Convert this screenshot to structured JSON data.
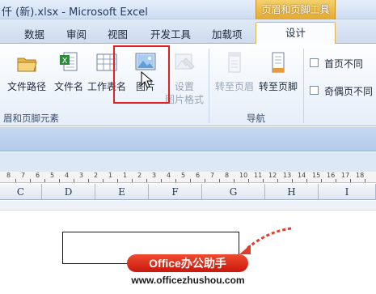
{
  "window": {
    "title": "仟 (新).xlsx - Microsoft Excel",
    "context_tab_title": "页眉和页脚工具"
  },
  "tabs": [
    {
      "label": "数据"
    },
    {
      "label": "审阅"
    },
    {
      "label": "视图"
    },
    {
      "label": "开发工具"
    },
    {
      "label": "加载项"
    }
  ],
  "active_tab": {
    "label": "设计"
  },
  "ribbon": {
    "elements_group": {
      "label": "眉和页脚元素",
      "buttons": [
        {
          "label": "文件路径",
          "icon": "folder-icon"
        },
        {
          "label": "文件名",
          "icon": "excel-file-icon"
        },
        {
          "label": "工作表名",
          "icon": "sheet-name-icon"
        },
        {
          "label": "图片",
          "icon": "picture-icon"
        },
        {
          "label": "设置",
          "label2": "图片格式",
          "icon": "format-picture-icon"
        }
      ]
    },
    "nav_group": {
      "label": "导航",
      "buttons": [
        {
          "label": "转至页眉",
          "icon": "goto-header-icon"
        },
        {
          "label": "转至页脚",
          "icon": "goto-footer-icon"
        }
      ]
    },
    "options": [
      {
        "label": "首页不同",
        "checked": false
      },
      {
        "label": "奇偶页不同",
        "checked": false
      }
    ]
  },
  "ruler": {
    "marks": [
      "8",
      "7",
      "6",
      "5",
      "4",
      "3",
      "2",
      "1",
      "1",
      "2",
      "3",
      "4",
      "5",
      "6",
      "7",
      "8",
      "10",
      "11",
      "12",
      "13",
      "14",
      "15",
      "16",
      "17",
      "18"
    ]
  },
  "columns": [
    "C",
    "D",
    "E",
    "F",
    "G",
    "H",
    "I"
  ],
  "watermark": {
    "brand": "Office办公助手",
    "url": "www.officezhushou.com"
  },
  "colors": {
    "accent_red": "#e22020",
    "context_tab": "#e3a92e",
    "ribbon_blue": "#cfdcef"
  }
}
